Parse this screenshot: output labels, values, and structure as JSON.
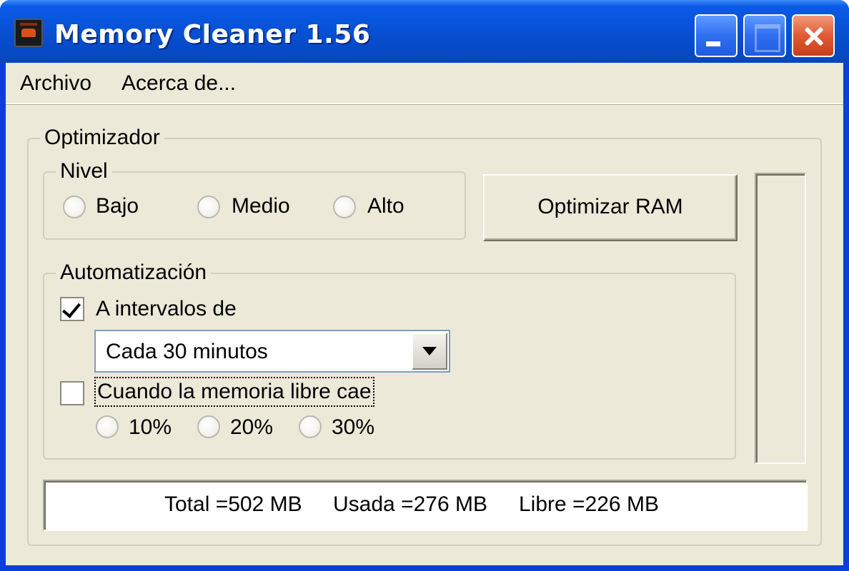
{
  "window": {
    "title": "Memory Cleaner 1.56",
    "colors": {
      "titlebar": "#0752d6",
      "close": "#e05a33",
      "client": "#ece9d8"
    }
  },
  "menu": {
    "items": [
      "Archivo",
      "Acerca de..."
    ]
  },
  "optimizador": {
    "title": "Optimizador",
    "nivel": {
      "title": "Nivel",
      "options": [
        "Bajo",
        "Medio",
        "Alto"
      ],
      "selected": null
    },
    "optimize_button": "Optimizar RAM",
    "memory_bar_level": 0
  },
  "automatizacion": {
    "title": "Automatización",
    "intervalos": {
      "label": "A intervalos de",
      "checked": true,
      "select_value": "Cada 30 minutos"
    },
    "memoria_libre": {
      "label": "Cuando la memoria libre cae",
      "checked": false,
      "options": [
        "10%",
        "20%",
        "30%"
      ]
    }
  },
  "status": {
    "total": "Total =502 MB",
    "usada": "Usada =276 MB",
    "libre": "Libre =226 MB"
  }
}
